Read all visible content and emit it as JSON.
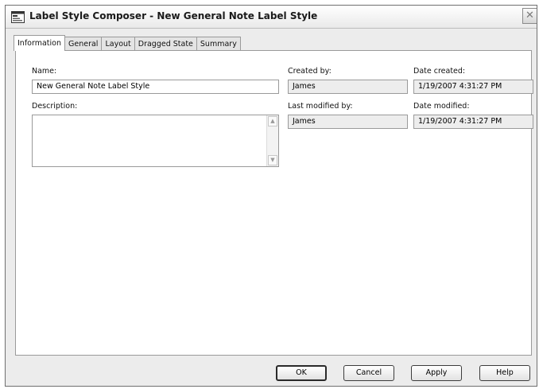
{
  "window": {
    "title": "Label Style Composer - New General Note Label Style",
    "close_glyph": "✕"
  },
  "tabs": [
    {
      "label": "Information",
      "active": true
    },
    {
      "label": "General",
      "active": false
    },
    {
      "label": "Layout",
      "active": false
    },
    {
      "label": "Dragged State",
      "active": false
    },
    {
      "label": "Summary",
      "active": false
    }
  ],
  "information": {
    "name_label": "Name:",
    "name_value": "New General Note Label Style",
    "description_label": "Description:",
    "description_value": "",
    "created_by_label": "Created by:",
    "created_by_value": "James",
    "date_created_label": "Date created:",
    "date_created_value": "1/19/2007 4:31:27 PM",
    "last_modified_by_label": "Last modified by:",
    "last_modified_by_value": "James",
    "date_modified_label": "Date modified:",
    "date_modified_value": "1/19/2007 4:31:27 PM"
  },
  "scrollbar": {
    "up_glyph": "▲",
    "down_glyph": "▼"
  },
  "buttons": {
    "ok": "OK",
    "cancel": "Cancel",
    "apply": "Apply",
    "help": "Help"
  },
  "icons": {
    "app": "label-style-composer-icon",
    "close": "close-icon"
  }
}
